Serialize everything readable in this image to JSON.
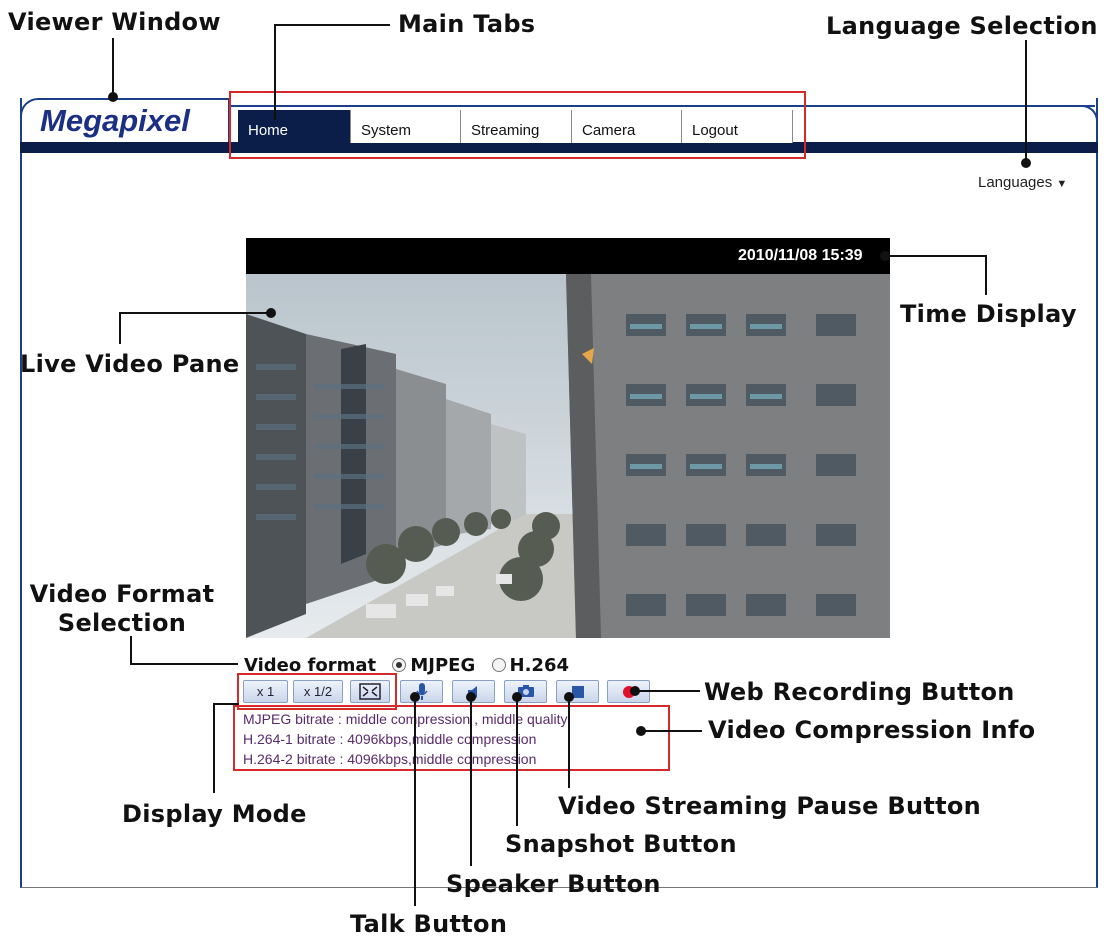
{
  "callouts": {
    "viewer_window": "Viewer Window",
    "main_tabs": "Main Tabs",
    "language_selection": "Language Selection",
    "time_display": "Time Display",
    "live_video_pane": "Live Video Pane",
    "video_format_selection": "Video Format Selection",
    "web_recording_button": "Web Recording Button",
    "video_compression_info": "Video Compression Info",
    "display_mode": "Display Mode",
    "video_streaming_pause_button": "Video Streaming Pause Button",
    "snapshot_button": "Snapshot Button",
    "speaker_button": "Speaker Button",
    "talk_button": "Talk Button"
  },
  "app": {
    "logo": "Megapixel",
    "tabs": [
      {
        "label": "Home",
        "active": true
      },
      {
        "label": "System",
        "active": false
      },
      {
        "label": "Streaming",
        "active": false
      },
      {
        "label": "Camera",
        "active": false
      },
      {
        "label": "Logout",
        "active": false
      }
    ],
    "languages_label": "Languages",
    "languages_icon": "triangle-down-icon"
  },
  "video": {
    "timestamp": "2010/11/08 15:39"
  },
  "format": {
    "label": "Video format",
    "options": [
      {
        "label": "MJPEG",
        "selected": true
      },
      {
        "label": "H.264",
        "selected": false
      }
    ]
  },
  "controls": {
    "display_x1": "x 1",
    "display_half": "x 1/2",
    "fullscreen_icon": "fullscreen-icon",
    "talk_icon": "microphone-icon",
    "speaker_icon": "speaker-icon",
    "snapshot_icon": "camera-icon",
    "pause_icon": "stop-icon",
    "record_icon": "record-icon"
  },
  "compression_info": [
    "MJPEG bitrate : middle compression , middle quality",
    "H.264-1 bitrate : 4096kbps,middle compression",
    "H.264-2 bitrate : 4096kbps,middle compression"
  ],
  "colors": {
    "accent_dark_blue": "#0b1e4a",
    "logo_blue": "#1b2f85",
    "highlight_red": "#d52a2a",
    "record_red": "#e0102a"
  }
}
